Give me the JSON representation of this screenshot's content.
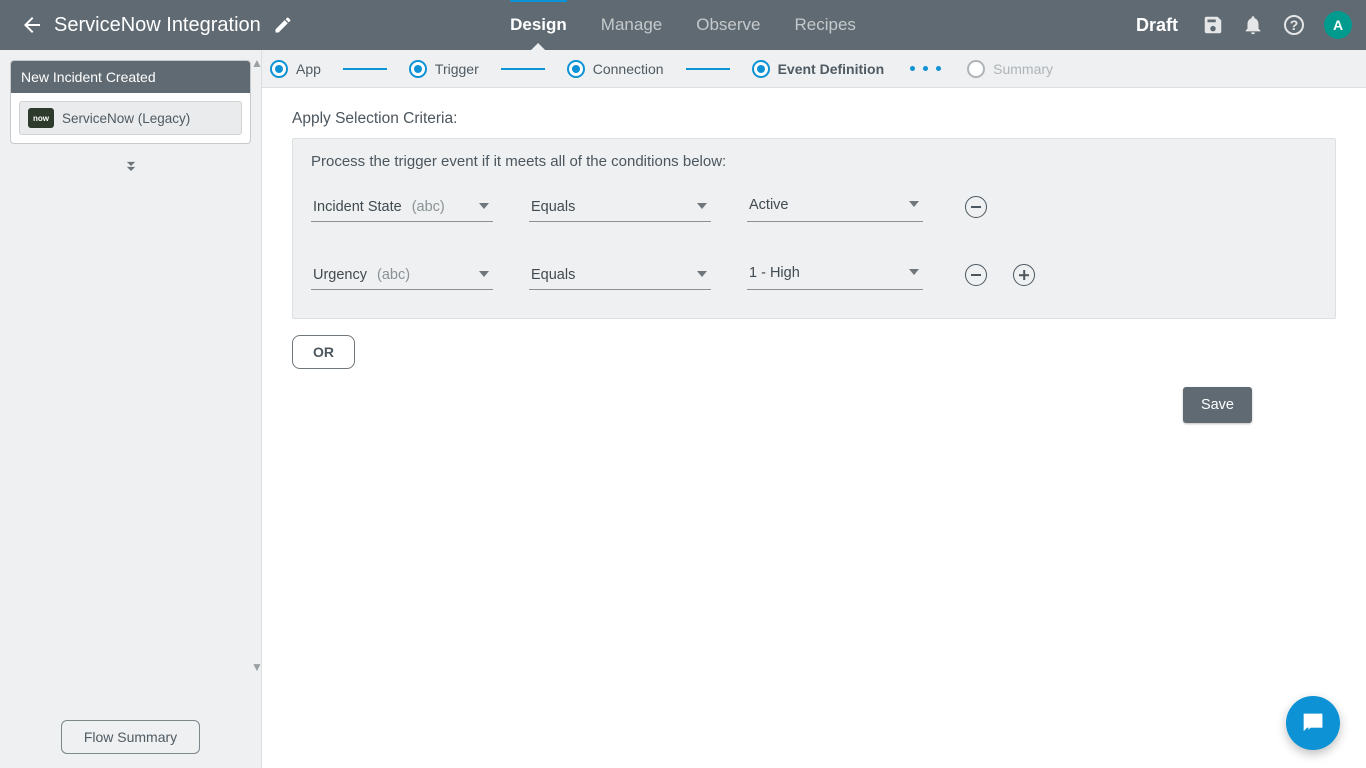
{
  "header": {
    "title": "ServiceNow Integration",
    "nav": {
      "design": "Design",
      "manage": "Manage",
      "observe": "Observe",
      "recipes": "Recipes"
    },
    "status": "Draft",
    "avatar_initial": "A"
  },
  "sidebar": {
    "flow_title": "New Incident Created",
    "node_label": "ServiceNow (Legacy)",
    "node_logo_text": "now",
    "flow_summary_button": "Flow Summary"
  },
  "stepper": {
    "app": "App",
    "trigger": "Trigger",
    "connection": "Connection",
    "event_definition": "Event Definition",
    "summary": "Summary"
  },
  "panel": {
    "heading": "Apply Selection Criteria:",
    "intro": "Process the trigger event if it meets all of the conditions below:",
    "conditions": [
      {
        "field": "Incident State",
        "type_hint": "(abc)",
        "operator": "Equals",
        "value": "Active"
      },
      {
        "field": "Urgency",
        "type_hint": "(abc)",
        "operator": "Equals",
        "value": "1 - High"
      }
    ],
    "or_button": "OR",
    "save_button": "Save"
  }
}
